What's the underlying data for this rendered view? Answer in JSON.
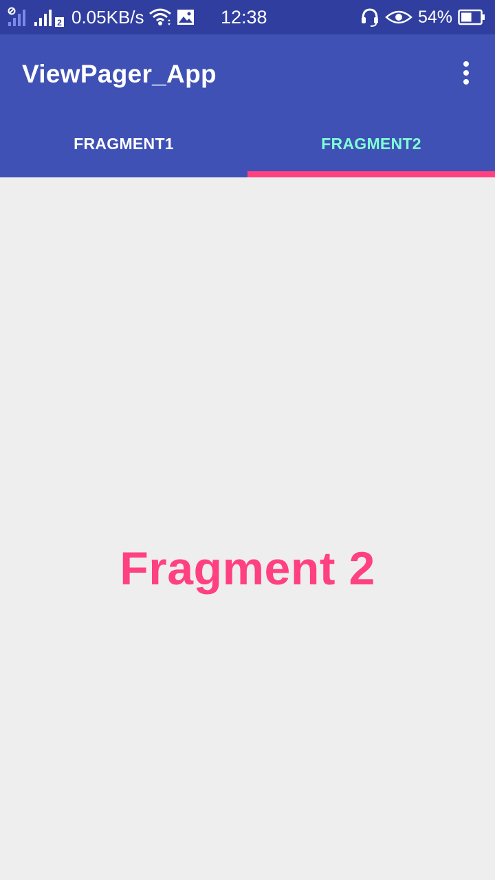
{
  "status_bar": {
    "net_speed": "0.05KB/s",
    "sim2_badge": "2",
    "time": "12:38",
    "battery_percent": "54%",
    "battery_level": 0.54,
    "icons": [
      "no-sim-signal-icon",
      "signal-icon",
      "wifi-icon",
      "image-notification-icon",
      "headset-icon",
      "eye-icon",
      "battery-icon"
    ]
  },
  "app_bar": {
    "title": "ViewPager_App",
    "overflow_icon": "more-vert-icon"
  },
  "tabs": [
    {
      "label": "FRAGMENT1",
      "selected": false
    },
    {
      "label": "FRAGMENT2",
      "selected": true
    }
  ],
  "content": {
    "text": "Fragment 2"
  },
  "colors": {
    "status_bar": "#303f9f",
    "primary": "#3f51b5",
    "accent": "#ff4081",
    "selected_tab_text": "#80ffd5",
    "background": "#eeeeee"
  }
}
